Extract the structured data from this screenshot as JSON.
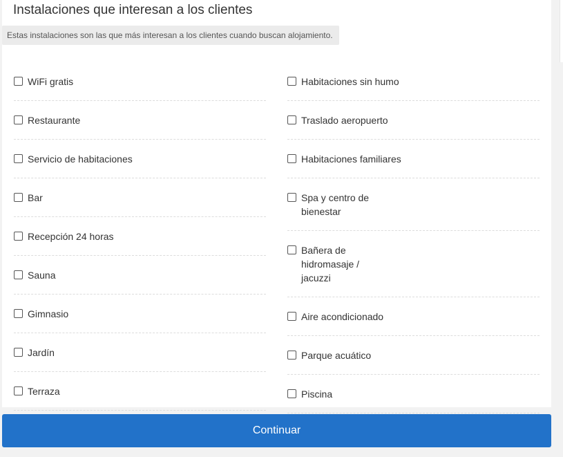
{
  "section": {
    "title": "Instalaciones que interesan a los clientes",
    "subtitle": "Estas instalaciones son las que más interesan a los clientes cuando buscan alojamiento."
  },
  "facilities": {
    "left": [
      {
        "label": "WiFi gratis",
        "checked": false
      },
      {
        "label": "Restaurante",
        "checked": false
      },
      {
        "label": "Servicio de habitaciones",
        "checked": false
      },
      {
        "label": "Bar",
        "checked": false
      },
      {
        "label": "Recepción 24 horas",
        "checked": false
      },
      {
        "label": "Sauna",
        "checked": false
      },
      {
        "label": "Gimnasio",
        "checked": false
      },
      {
        "label": "Jardín",
        "checked": false
      },
      {
        "label": "Terraza",
        "checked": false
      }
    ],
    "right": [
      {
        "label": "Habitaciones sin humo",
        "checked": false
      },
      {
        "label": "Traslado aeropuerto",
        "checked": false
      },
      {
        "label": "Habitaciones familiares",
        "checked": false
      },
      {
        "label": "Spa y centro de bienestar",
        "checked": false
      },
      {
        "label": "Bañera de hidromasaje / jacuzzi",
        "checked": false
      },
      {
        "label": "Aire acondicionado",
        "checked": false
      },
      {
        "label": "Parque acuático",
        "checked": false
      },
      {
        "label": "Piscina",
        "checked": false
      }
    ]
  },
  "actions": {
    "continue_label": "Continuar"
  },
  "colors": {
    "primary": "#2272c9",
    "background": "#f2f2f2",
    "card": "#ffffff"
  }
}
